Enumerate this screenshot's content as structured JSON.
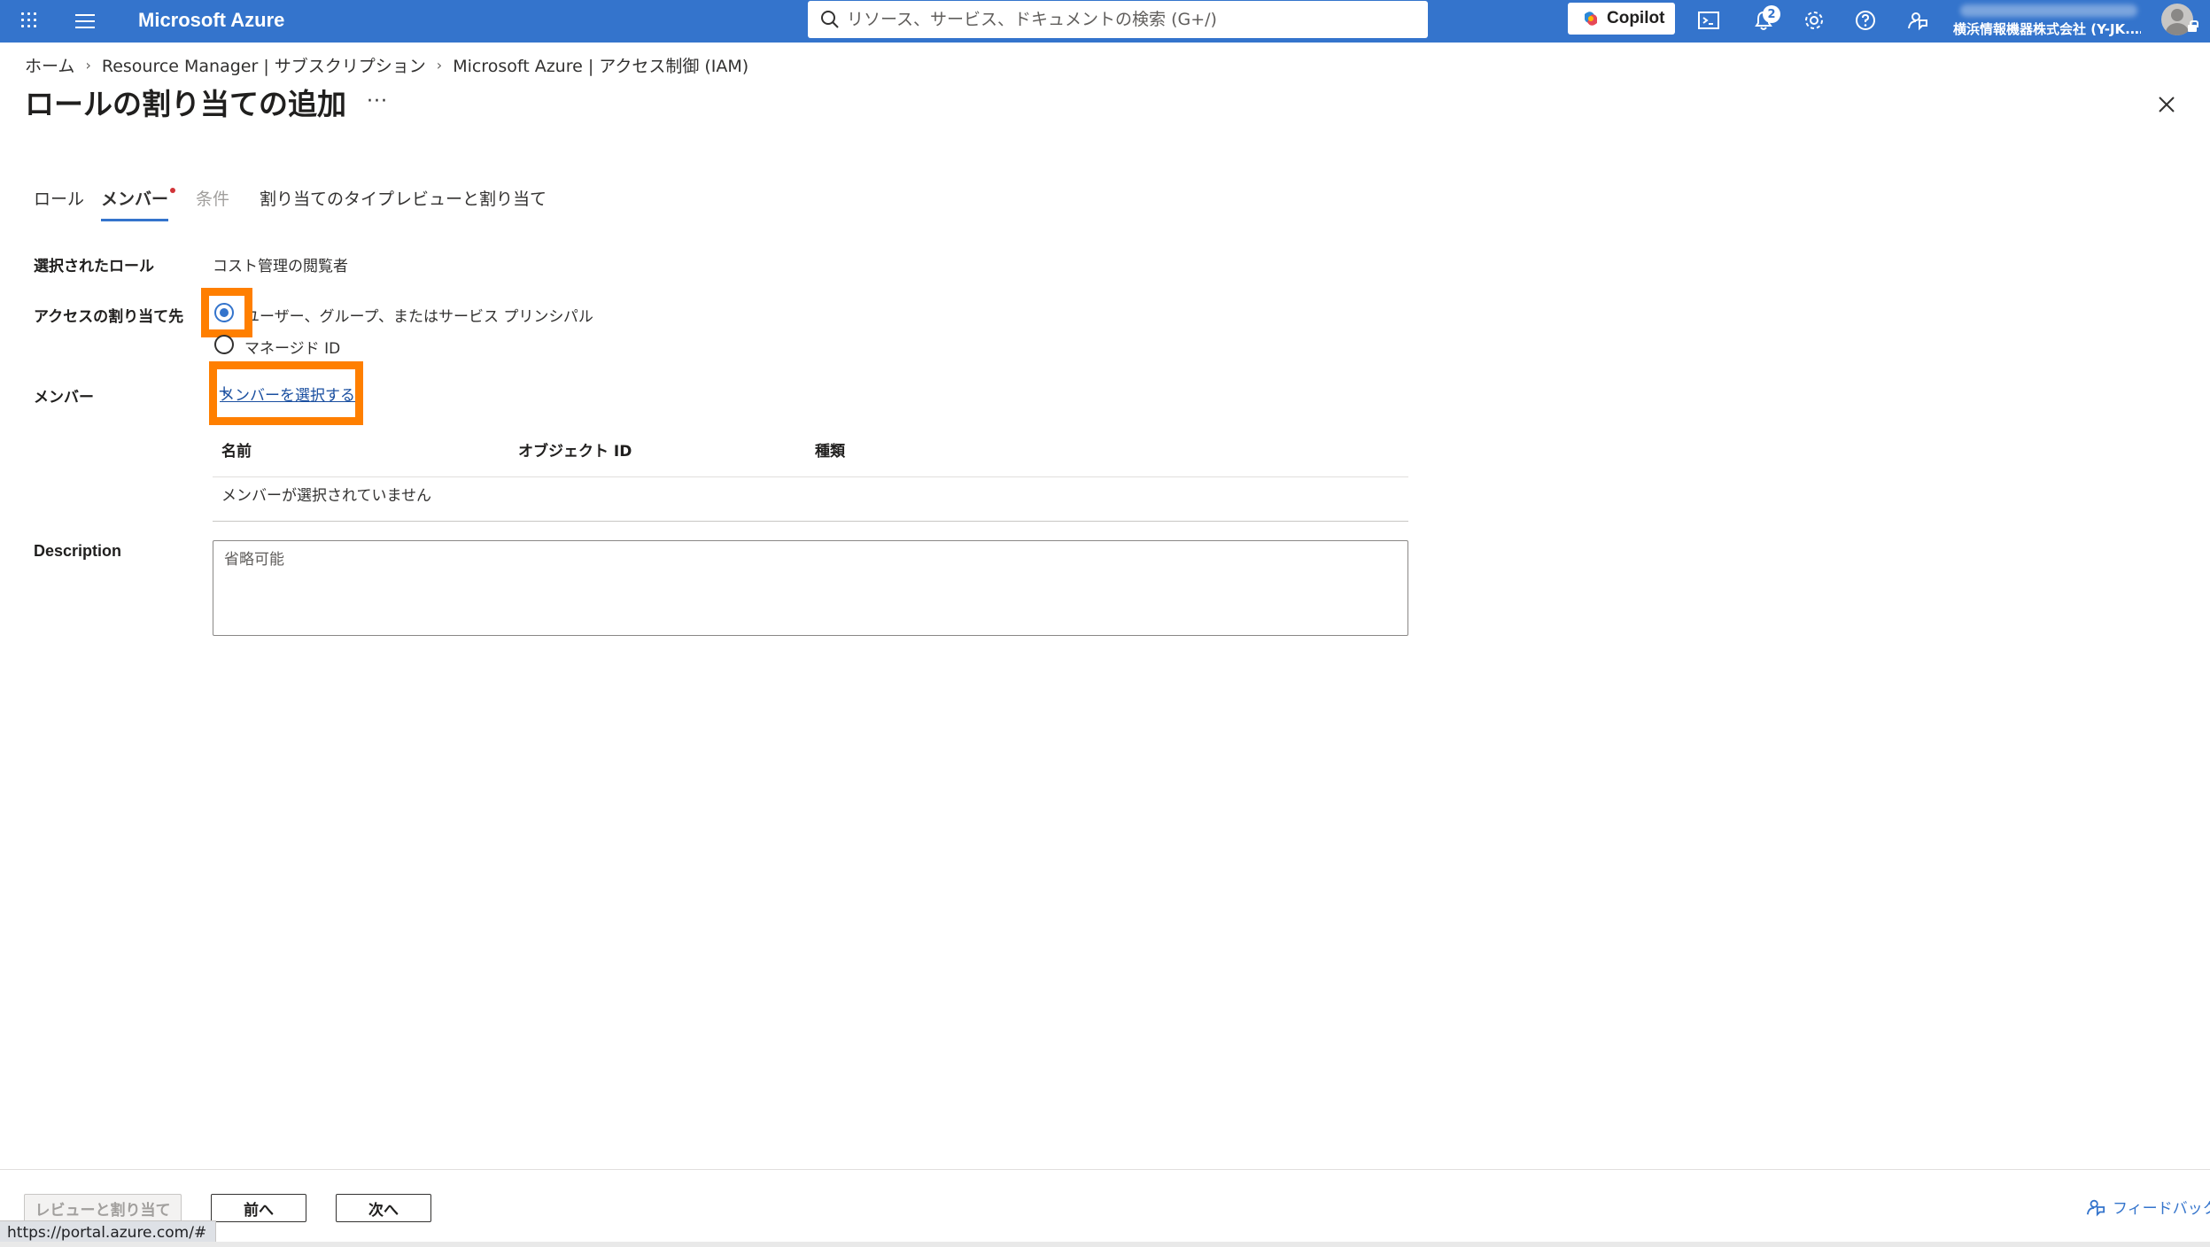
{
  "topbar": {
    "brand": "Microsoft Azure",
    "search_placeholder": "リソース、サービス、ドキュメントの検索 (G+/)",
    "copilot_label": "Copilot",
    "notification_count": "2",
    "tenant": "横浜情報機器株式会社 (Y-JK.…"
  },
  "breadcrumb": [
    "ホーム",
    "Resource Manager | サブスクリプション",
    "Microsoft Azure | アクセス制御 (IAM)"
  ],
  "page_title": "ロールの割り当ての追加",
  "more_label": "···",
  "tabs": [
    {
      "label": "ロール"
    },
    {
      "label": "メンバー"
    },
    {
      "label": "条件"
    },
    {
      "label": "割り当てのタイプ"
    },
    {
      "label": "レビューと割り当て"
    }
  ],
  "form": {
    "selected_role_label": "選択されたロール",
    "selected_role_value": "コスト管理の閲覧者",
    "assign_access_label": "アクセスの割り当て先",
    "option_user": "ユーザー、グループ、またはサービス プリンシパル",
    "option_managed": "マネージド ID",
    "members_label": "メンバー",
    "select_members": "メンバーを選択する",
    "grid_headers": [
      "名前",
      "オブジェクト ID",
      "種類"
    ],
    "grid_empty": "メンバーが選択されていません",
    "description_label": "Description",
    "description_placeholder": "省略可能"
  },
  "footer": {
    "review_assign": "レビューと割り当て",
    "prev": "前へ",
    "next": "次へ",
    "feedback": "フィードバック",
    "status_url": "https://portal.azure.com/#"
  },
  "colors": {
    "topbar": "#3474cc",
    "highlight": "#ff7f00",
    "link": "#1a4fa0"
  }
}
